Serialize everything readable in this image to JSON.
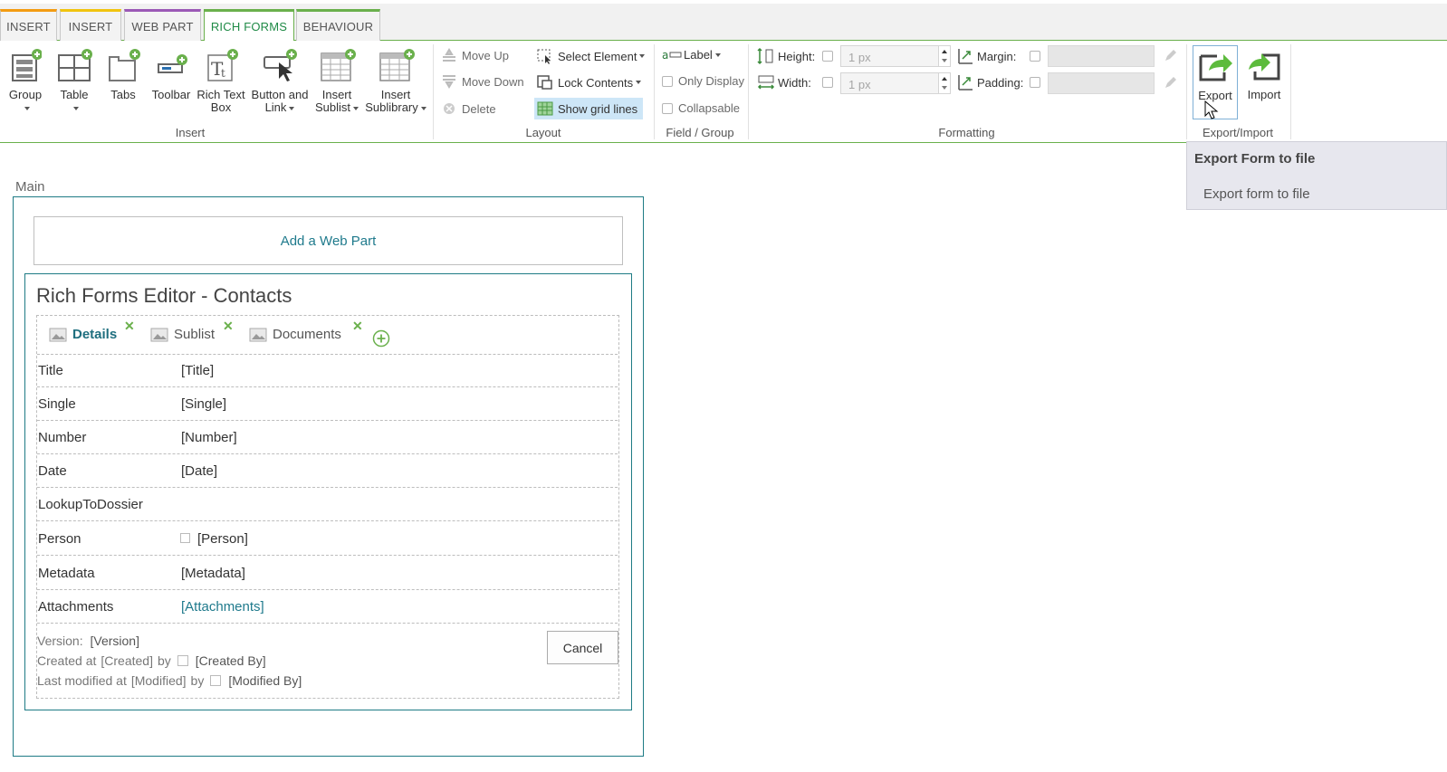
{
  "tabs": [
    {
      "label": "INSERT",
      "accent": "#f39c12"
    },
    {
      "label": "INSERT",
      "accent": "#f1c40f"
    },
    {
      "label": "WEB PART",
      "accent": "#9b59b6"
    },
    {
      "label": "RICH FORMS",
      "accent": "#6ab04c",
      "active": true
    },
    {
      "label": "BEHAVIOUR",
      "accent": "#6ab04c"
    }
  ],
  "ribbon": {
    "insert": {
      "group_label": "Insert",
      "group": "Group",
      "table": "Table",
      "tabs": "Tabs",
      "toolbar": "Toolbar",
      "richtext_1": "Rich Text",
      "richtext_2": "Box",
      "button_1": "Button and",
      "button_2": "Link",
      "sublist_1": "Insert",
      "sublist_2": "Sublist",
      "sublibrary_1": "Insert",
      "sublibrary_2": "Sublibrary"
    },
    "layout": {
      "group_label": "Layout",
      "move_up": "Move Up",
      "move_down": "Move Down",
      "delete": "Delete",
      "select_element": "Select Element",
      "lock_contents": "Lock Contents",
      "show_grid_lines": "Show grid lines"
    },
    "field_group": {
      "group_label": "Field / Group",
      "label": "Label",
      "only_display": "Only Display",
      "collapsable": "Collapsable"
    },
    "formatting": {
      "group_label": "Formatting",
      "height": "Height:",
      "width": "Width:",
      "height_value": "1 px",
      "width_value": "1 px",
      "margin": "Margin:",
      "padding": "Padding:"
    },
    "export_import": {
      "group_label": "Export/Import",
      "export": "Export",
      "import": "Import"
    }
  },
  "tooltip": {
    "title": "Export Form to file",
    "description": "Export form to file"
  },
  "zone_label": "Main",
  "add_web_part": "Add a Web Part",
  "form": {
    "title": "Rich Forms Editor - Contacts",
    "form_tabs": [
      "Details",
      "Sublist",
      "Documents"
    ],
    "fields": [
      {
        "label": "Title",
        "value": "[Title]"
      },
      {
        "label": "Single",
        "value": "[Single]"
      },
      {
        "label": "Number",
        "value": "[Number]"
      },
      {
        "label": "Date",
        "value": "[Date]"
      },
      {
        "label": "LookupToDossier",
        "value": ""
      },
      {
        "label": "Person",
        "value": "[Person]"
      },
      {
        "label": "Metadata",
        "value": "[Metadata]"
      },
      {
        "label": "Attachments",
        "value": "[Attachments]"
      }
    ],
    "footer": {
      "version_label": "Version:",
      "version_value": "[Version]",
      "created_label": "Created at",
      "created_value": "[Created]",
      "by1": "by",
      "created_by": "[Created By]",
      "modified_label": "Last modified at",
      "modified_value": "[Modified]",
      "by2": "by",
      "modified_by": "[Modified By]"
    },
    "cancel": "Cancel"
  },
  "colors": {
    "green": "#6ab04c",
    "teal": "#1e7b85",
    "link": "#1f7a8c",
    "highlight": "#cde6f7"
  }
}
